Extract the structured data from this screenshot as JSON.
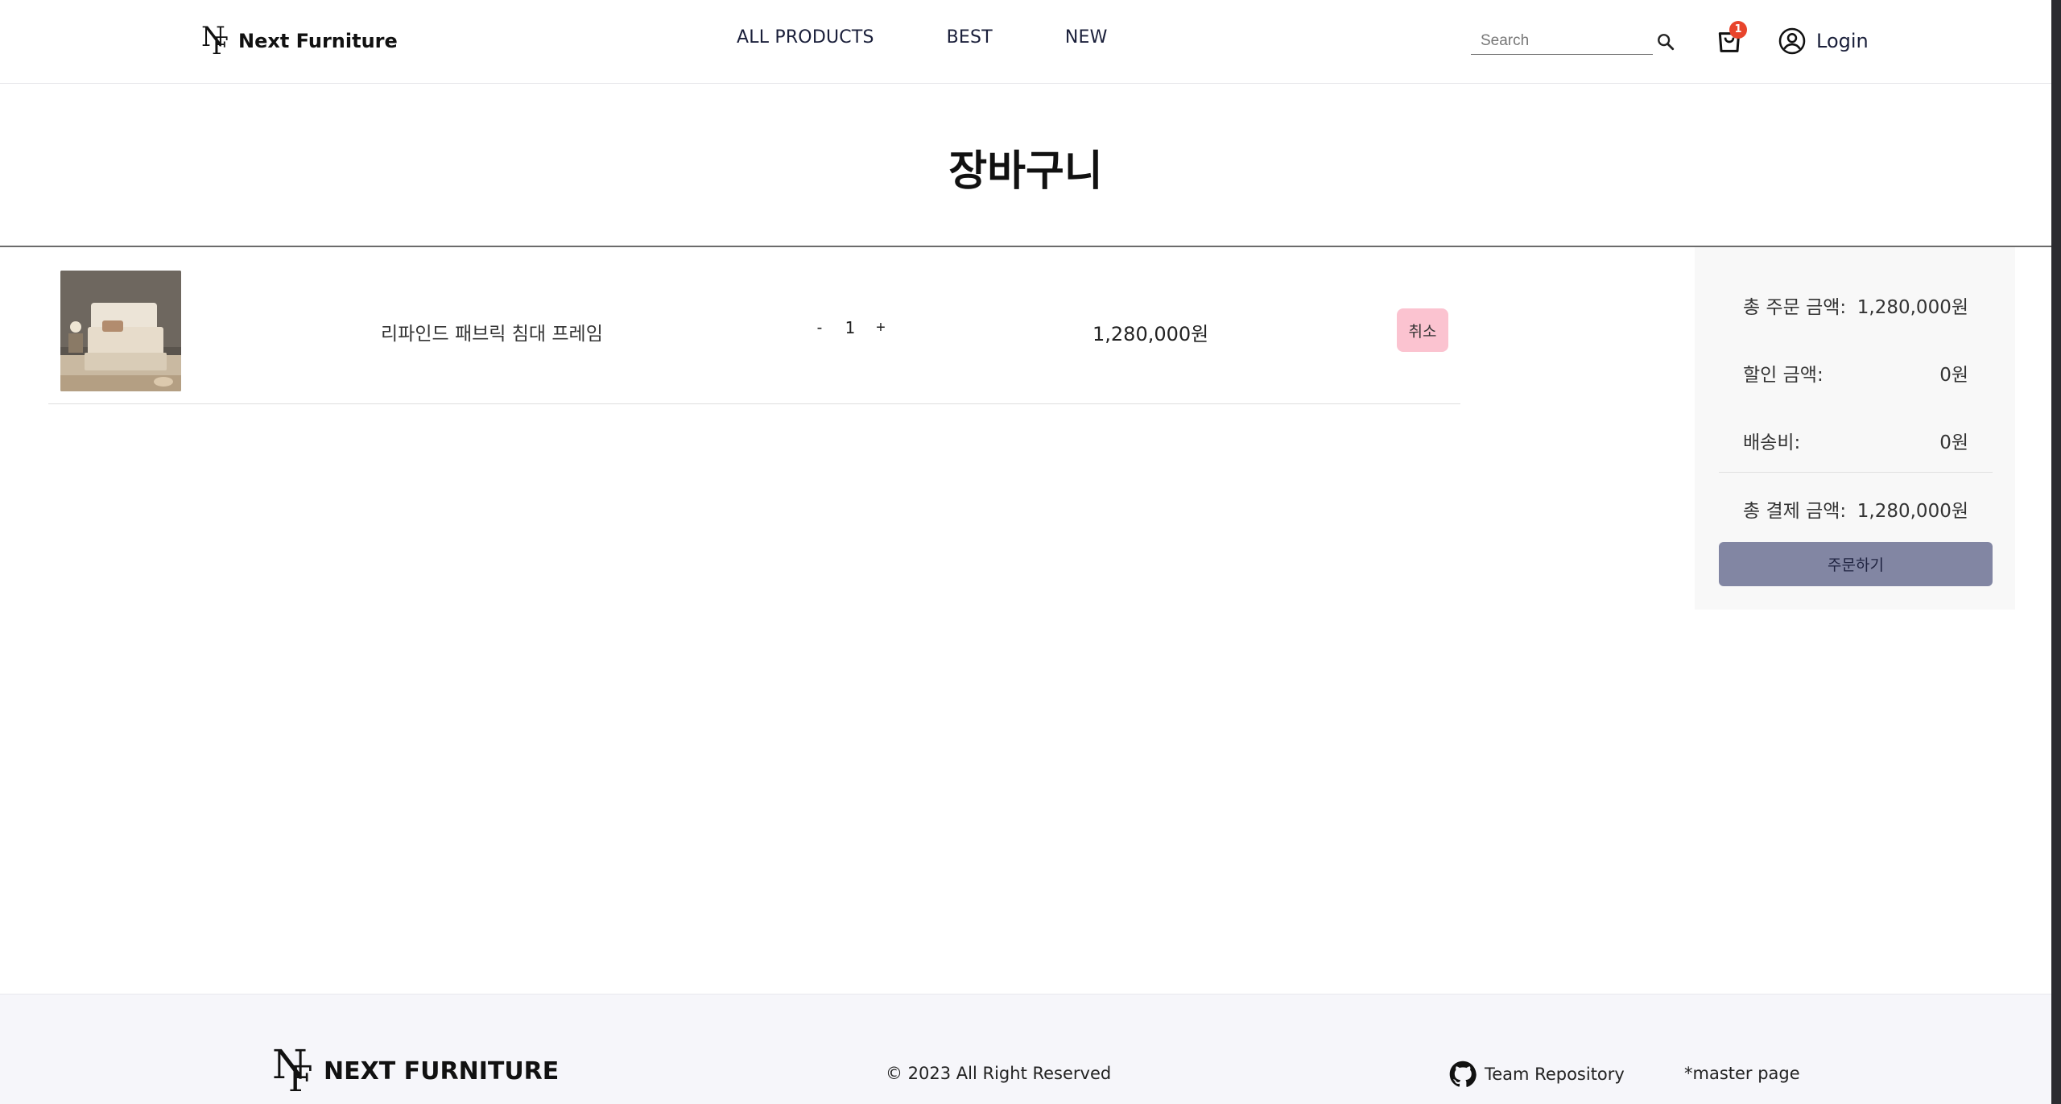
{
  "brand": {
    "name": "Next Furniture",
    "mark_n": "N",
    "mark_f": "F"
  },
  "nav": {
    "items": [
      "ALL PRODUCTS",
      "BEST",
      "NEW"
    ]
  },
  "search": {
    "placeholder": "Search",
    "icon": "search-icon"
  },
  "cart": {
    "icon": "shopping-bag-icon",
    "badge_count": "1"
  },
  "account": {
    "icon": "user-circle-icon",
    "login_label": "Login"
  },
  "page": {
    "title": "장바구니"
  },
  "cart_items": [
    {
      "name": "리파인드 패브릭 침대 프레임",
      "quantity": "1",
      "decrement_label": "-",
      "increment_label": "+",
      "price": "1,280,000원",
      "cancel_label": "취소"
    }
  ],
  "summary": {
    "total_order_label": "총 주문 금액:",
    "total_order_value": "1,280,000원",
    "discount_label": "할인 금액:",
    "discount_value": "0원",
    "shipping_label": "배송비:",
    "shipping_value": "0원",
    "total_payment_label": "총 결제 금액:",
    "total_payment_value": "1,280,000원",
    "order_button": "주문하기"
  },
  "footer": {
    "brand": "NEXT FURNITURE",
    "copyright": "© 2023 All Right Reserved",
    "repo_label": "Team Repository",
    "repo_icon": "github-icon",
    "master_label": "*master page"
  },
  "colors": {
    "accent": "#8286a3",
    "cancel": "#fbc3d0",
    "badge": "#e8452c",
    "footer_bg": "#f6f6fa",
    "summary_bg": "#f8f8f8"
  }
}
